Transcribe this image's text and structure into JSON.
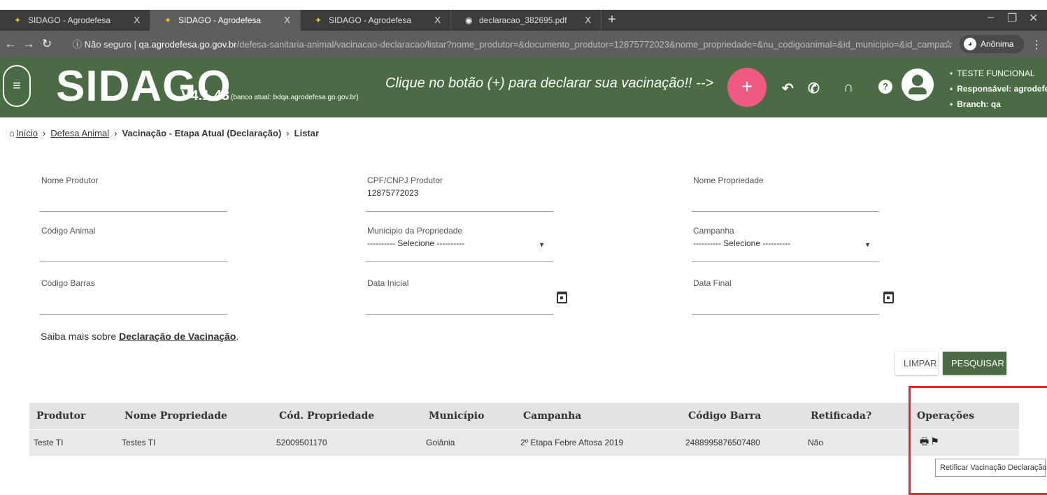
{
  "browser": {
    "tabs": [
      {
        "title": "SIDAGO - Agrodefesa",
        "active": false,
        "icon": "sidago-favicon"
      },
      {
        "title": "SIDAGO - Agrodefesa",
        "active": true,
        "icon": "sidago-favicon"
      },
      {
        "title": "SIDAGO - Agrodefesa",
        "active": false,
        "icon": "sidago-favicon"
      },
      {
        "title": "declaracao_382695.pdf",
        "active": false,
        "icon": "globe-icon"
      }
    ],
    "tab_close": "X",
    "new_tab": "+",
    "url_security": "Não seguro",
    "url_host": "qa.agrodefesa.go.gov.br",
    "url_path": "/defesa-sanitaria-animal/vacinacao-declaracao/listar?nome_produtor=&documento_produtor=12875772023&nome_propriedade=&nu_codigoanimal=&id_municipio=&id_campa...",
    "profile_label": "Anônima"
  },
  "header": {
    "logo": "SIDAGO",
    "version": "V4.1.43",
    "database": "(banco atual: bdqa.agrodefesa.go.gov.br)",
    "slogan": "Clique no botão (+) para declarar sua vacinação!! -->",
    "plus_label": "+",
    "user_info": [
      "TESTE FUNCIONAL",
      "Responsável: agrodefesa",
      "Branch: qa"
    ]
  },
  "breadcrumb": {
    "items": [
      "Início",
      "Defesa Animal",
      "Vacinação - Etapa Atual (Declaração)",
      "Listar"
    ]
  },
  "form": {
    "nome_produtor": {
      "label": "Nome Produtor",
      "value": ""
    },
    "cpf_cnpj": {
      "label": "CPF/CNPJ Produtor",
      "value": "12875772023"
    },
    "nome_propriedade": {
      "label": "Nome Propriedade",
      "value": ""
    },
    "codigo_animal": {
      "label": "Código Animal",
      "value": ""
    },
    "municipio": {
      "label": "Municipio da Propriedade",
      "value": "---------- Selecione ----------"
    },
    "campanha": {
      "label": "Campanha",
      "value": "---------- Selecione ----------"
    },
    "codigo_barras": {
      "label": "Código Barras",
      "value": ""
    },
    "data_inicial": {
      "label": "Data Inicial",
      "value": ""
    },
    "data_final": {
      "label": "Data Final",
      "value": ""
    },
    "saiba_prefix": "Saiba mais sobre ",
    "saiba_link": "Declaração de Vacinação",
    "saiba_suffix": ".",
    "limpar": "LIMPAR",
    "pesquisar": "PESQUISAR"
  },
  "table": {
    "headers": [
      "Produtor",
      "Nome Propriedade",
      "Cód. Propriedade",
      "Município",
      "Campanha",
      "Código Barra",
      "Retificada?",
      "Operações"
    ],
    "rows": [
      [
        "Teste TI",
        "Testes TI",
        "52009501170",
        "Goiânia",
        "2º Etapa Febre Aftosa 2019",
        "2488995876507480",
        "Não"
      ]
    ]
  },
  "tooltip": "Retificar Vacinação Declaração",
  "colors": {
    "header_green": "#4a6b43",
    "plus_pink": "#ef5a83",
    "highlight_red": "#e3242b"
  }
}
